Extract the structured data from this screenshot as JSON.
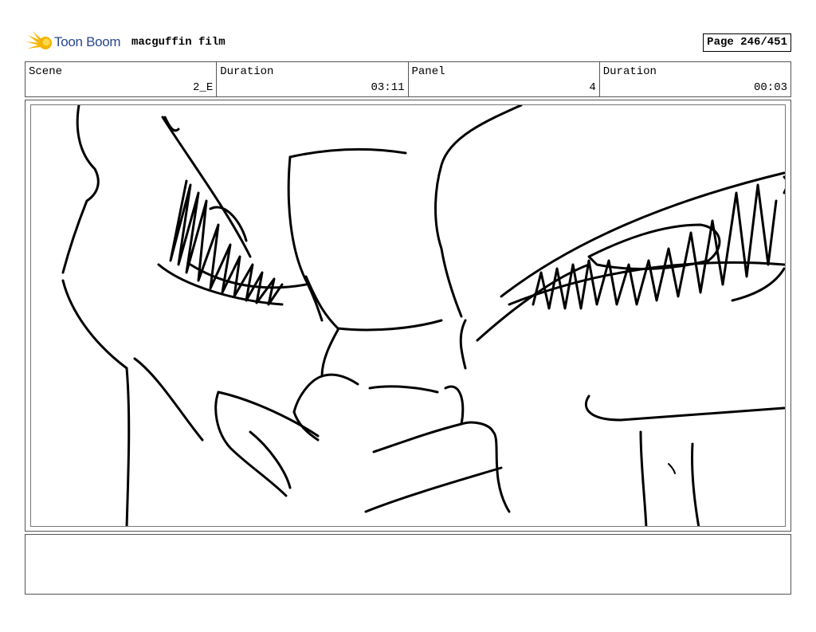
{
  "header": {
    "brand": "Toon Boom",
    "film_title": "macguffin film",
    "page_label": "Page 246/451"
  },
  "info": {
    "scene_label": "Scene",
    "scene_value": "2_E",
    "scene_duration_label": "Duration",
    "scene_duration_value": "03:11",
    "panel_label": "Panel",
    "panel_value": "4",
    "panel_duration_label": "Duration",
    "panel_duration_value": "00:03"
  },
  "notes": {
    "text": ""
  },
  "colors": {
    "brand_blue": "#27478f",
    "brand_yellow": "#f5b400"
  }
}
